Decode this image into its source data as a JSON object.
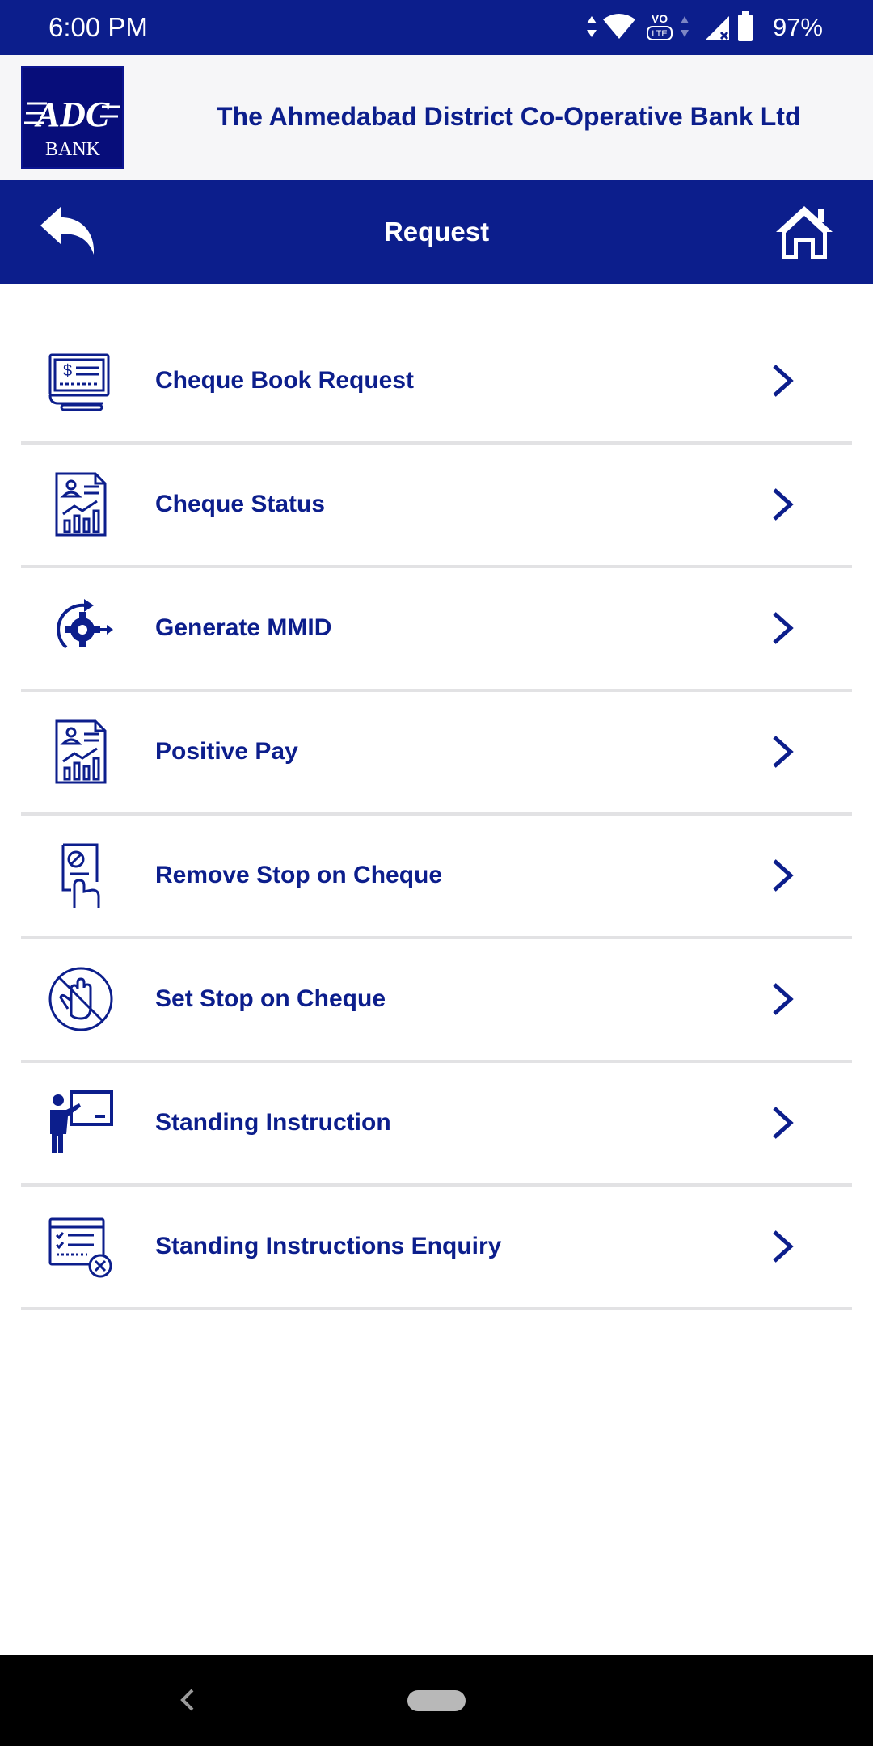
{
  "status_bar": {
    "time": "6:00 PM",
    "battery": "97%",
    "icons": [
      "data-arrows-icon",
      "wifi-icon",
      "volte-icon",
      "signal-icon",
      "battery-icon"
    ]
  },
  "brand": {
    "logo_text": "ADC",
    "logo_subtext": "BANK",
    "bank_name": "The Ahmedabad District Co-Operative Bank Ltd"
  },
  "nav": {
    "title": "Request",
    "back_icon": "back-arrow-icon",
    "home_icon": "home-icon"
  },
  "menu": {
    "items": [
      {
        "label": "Cheque Book Request",
        "icon": "cheque-book-icon"
      },
      {
        "label": "Cheque Status",
        "icon": "report-chart-icon"
      },
      {
        "label": "Generate MMID",
        "icon": "gear-arrow-icon"
      },
      {
        "label": "Positive Pay",
        "icon": "report-chart-icon"
      },
      {
        "label": "Remove Stop on Cheque",
        "icon": "hand-document-icon"
      },
      {
        "label": "Set Stop on Cheque",
        "icon": "stop-hand-icon"
      },
      {
        "label": "Standing Instruction",
        "icon": "presenter-board-icon"
      },
      {
        "label": "Standing Instructions Enquiry",
        "icon": "checklist-cancel-icon"
      }
    ]
  },
  "colors": {
    "primary": "#0c1e8c",
    "logo_bg": "#070d7a",
    "divider": "#e2e2e4",
    "brand_bg": "#f6f6f8"
  }
}
